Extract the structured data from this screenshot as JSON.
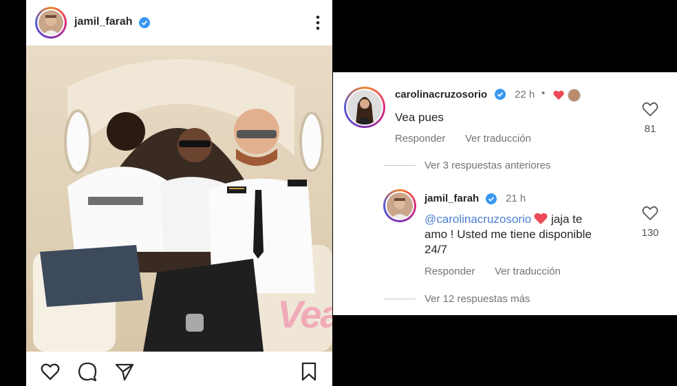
{
  "post": {
    "username": "jamil_farah",
    "watermark": "Vea",
    "icons": [
      "like-heart-icon",
      "comment-icon",
      "share-icon",
      "save-icon",
      "more-options-icon",
      "verified-badge-icon"
    ]
  },
  "comments": {
    "top": {
      "username": "carolinacruzosorio",
      "time": "22 h",
      "text": "Vea pues",
      "reply_label": "Responder",
      "translate_label": "Ver traducción",
      "likes": "81"
    },
    "view_previous": "Ver 3 respuestas anteriores",
    "reply": {
      "username": "jamil_farah",
      "time": "21 h",
      "mention": "@carolinacruzosorio",
      "text_line1": " jaja te",
      "text_line2": "amo ! Usted me tiene disponible",
      "text_line3": "24/7",
      "reply_label": "Responder",
      "translate_label": "Ver traducción",
      "likes": "130"
    },
    "view_more": "Ver 12 respuestas más"
  },
  "colors": {
    "verified": "#3897f0",
    "heart": "#ed4956",
    "mention": "#4a7fd0"
  }
}
